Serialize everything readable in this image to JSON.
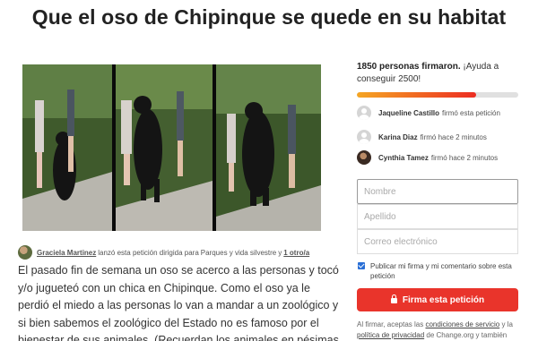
{
  "page": {
    "title": "Que el oso de Chipinque se quede en su habitat"
  },
  "photo": {
    "alt": "",
    "colors": {
      "forest": "#3f5a2c",
      "road": "#b8b6ae",
      "bear": "#141414"
    }
  },
  "starter": {
    "name": "Graciela Martinez",
    "text": "lanzó esta petición dirigida para",
    "target": "Parques y vida silvestre",
    "connector": "y",
    "more": "1 otro/a"
  },
  "description": "El pasado fin de semana un oso se acerco a las personas y tocó y/o jugueteó con un chica en Chipinque. Como el oso ya le perdió el miedo a las personas lo van a mandar a un zoológico y si bien sabemos el zoológico del Estado no es famoso por el bienestar de sus animales. (Recuerdan los animales en pésimas",
  "signatures": {
    "count_text": "1850 personas firmaron.",
    "goal_text": " ¡Ayuda a conseguir 2500!",
    "progress": 0.74,
    "colors": {
      "start": "#f5a623",
      "end": "#ec2c22",
      "track": "#e0e0e0"
    }
  },
  "recent_signers": [
    {
      "name": "Jaqueline Castillo",
      "action": "firmó esta petición"
    },
    {
      "name": "Karina Diaz",
      "action": "firmó hace 2 minutos"
    },
    {
      "name": "Cynthia Tamez",
      "action": "firmó hace 2 minutos"
    }
  ],
  "form": {
    "name_placeholder": "Nombre",
    "surname_placeholder": "Apellido",
    "email_placeholder": "Correo electrónico",
    "display_label": "Publicar mi firma y mi comentario sobre esta petición",
    "display_checked": true,
    "submit_label": "Firma esta petición",
    "accent": "#e9342b"
  },
  "legal": {
    "prefix": "Al firmar, aceptas las",
    "tos": "condiciones de servicio",
    "connector": "y la",
    "privacy": "política de privacidad",
    "suffix": "de Change.org y también"
  }
}
